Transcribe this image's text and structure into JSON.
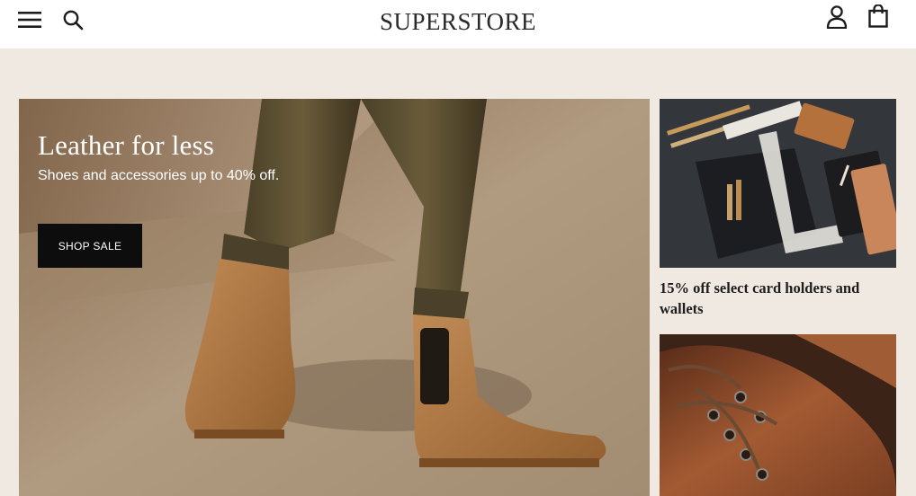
{
  "header": {
    "logo": "SUPERSTORE",
    "icons": {
      "menu": "hamburger-menu-icon",
      "search": "search-icon",
      "account": "user-icon",
      "cart": "shopping-bag-icon"
    }
  },
  "hero": {
    "title": "Leather for less",
    "subtitle": "Shoes and accessories up to 40% off.",
    "cta_label": "SHOP SALE"
  },
  "promos": [
    {
      "caption": "15% off select card holders and wallets"
    },
    {
      "caption": ""
    }
  ],
  "colors": {
    "header_bg": "#ffffff",
    "page_bg": "#efe9e1",
    "button_bg": "#0d0d0d",
    "text": "#1d1d1d"
  }
}
